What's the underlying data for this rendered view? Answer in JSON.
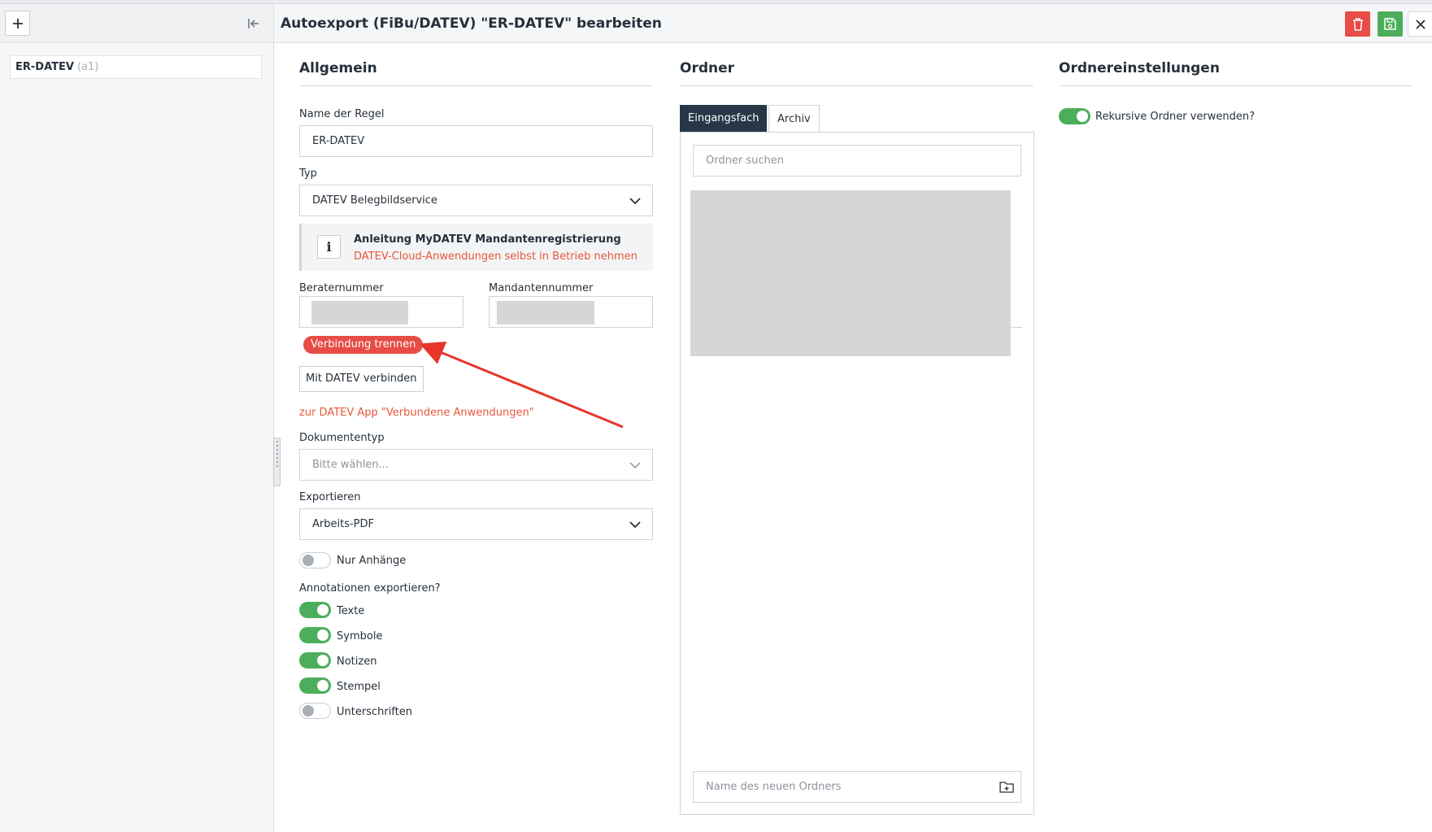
{
  "header": {
    "title": "Autoexport (FiBu/DATEV) \"ER-DATEV\" bearbeiten",
    "icons": {
      "delete": "trash-icon",
      "save": "save-icon",
      "close": "close-icon"
    },
    "colors": {
      "delete": "#e74c46",
      "save": "#4cae5b"
    }
  },
  "sidebar": {
    "add_icon": "plus-icon",
    "collapse_icon": "collapse-left-icon",
    "items": [
      {
        "name": "ER-DATEV",
        "sub": "(a1)"
      }
    ]
  },
  "general": {
    "title": "Allgemein",
    "rule_name_label": "Name der Regel",
    "rule_name_value": "ER-DATEV",
    "type_label": "Typ",
    "type_value": "DATEV Belegbildservice",
    "info": {
      "title": "Anleitung MyDATEV Mandantenregistrierung",
      "link": "DATEV-Cloud-Anwendungen selbst in Betrieb nehmen"
    },
    "advisor_label": "Beraternummer",
    "client_label": "Mandantennummer",
    "disconnect_label": "Verbindung trennen",
    "connect_label": "Mit DATEV verbinden",
    "app_link": "zur DATEV App \"Verbundene Anwendungen\"",
    "doctype_label": "Dokumententyp",
    "doctype_placeholder": "Bitte wählen...",
    "export_label": "Exportieren",
    "export_value": "Arbeits-PDF",
    "only_attachments_label": "Nur Anhänge",
    "only_attachments": false,
    "annotations_label": "Annotationen exportieren?",
    "annotations": [
      {
        "label": "Texte",
        "on": true
      },
      {
        "label": "Symbole",
        "on": true
      },
      {
        "label": "Notizen",
        "on": true
      },
      {
        "label": "Stempel",
        "on": true
      },
      {
        "label": "Unterschriften",
        "on": false
      }
    ]
  },
  "folders": {
    "title": "Ordner",
    "tabs": [
      "Eingangsfach",
      "Archiv"
    ],
    "active_tab": "Eingangsfach",
    "search_placeholder": "Ordner suchen",
    "new_folder_placeholder": "Name des neuen Ordners",
    "new_folder_icon": "folder-plus-icon"
  },
  "folder_settings": {
    "title": "Ordnereinstellungen",
    "recursive_label": "Rekursive Ordner verwenden?",
    "recursive": true
  },
  "colors": {
    "accent_orange": "#e8583b",
    "toggle_on": "#4cae5b",
    "tab_active": "#283747"
  }
}
